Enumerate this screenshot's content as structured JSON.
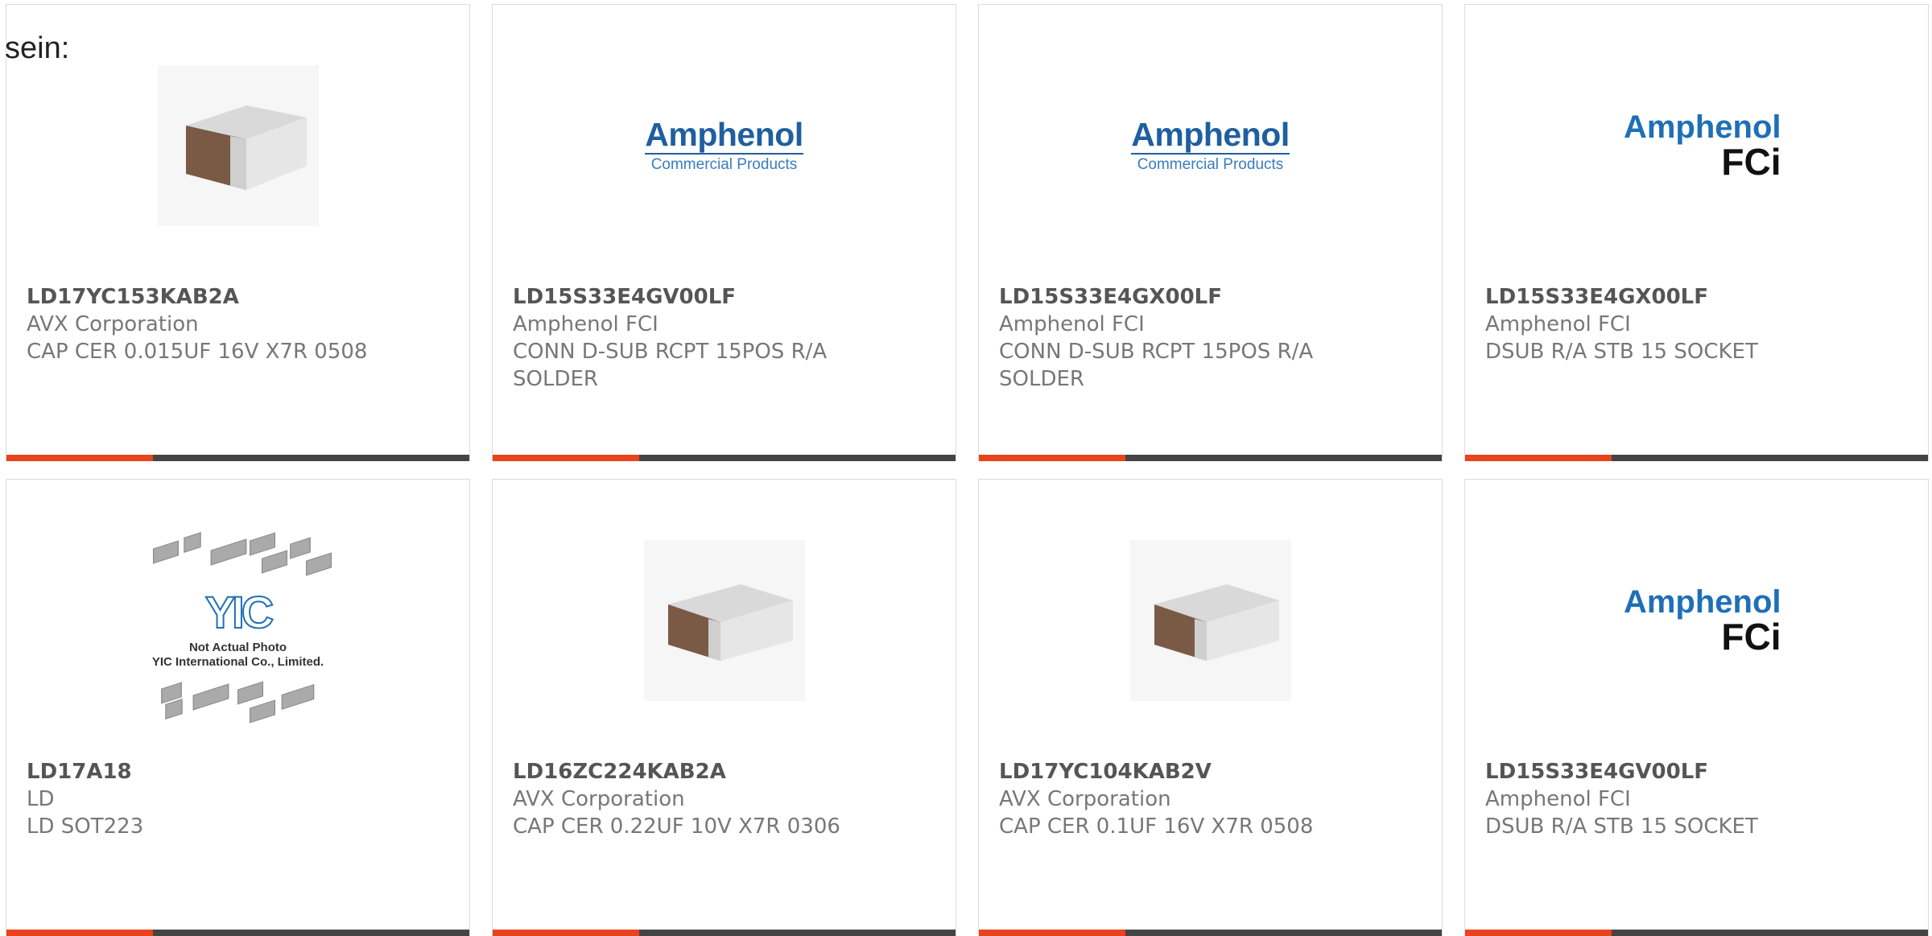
{
  "page": {
    "partial_label": "sein:"
  },
  "colors": {
    "accent_bar": "#e8431c",
    "dark_bar": "#444444",
    "amphenol_blue": "#1f6fb8",
    "capacitor_brown": "#7a5a45"
  },
  "logos": {
    "amphenol": "Amphenol",
    "commercial_products": "Commercial Products",
    "fci": "FCi",
    "yic": "YIC",
    "yic_notice_line1": "Not Actual Photo",
    "yic_notice_line2": "YIC International Co., Limited."
  },
  "products": [
    {
      "part_number": "LD17YC153KAB2A",
      "manufacturer": "AVX Corporation",
      "description": "CAP CER 0.015UF 16V X7R 0508",
      "image": "capacitor-chip"
    },
    {
      "part_number": "LD15S33E4GV00LF",
      "manufacturer": "Amphenol FCI",
      "description": "CONN D-SUB RCPT 15POS R/A SOLDER",
      "image": "amphenol-commercial-logo"
    },
    {
      "part_number": "LD15S33E4GX00LF",
      "manufacturer": "Amphenol FCI",
      "description": "CONN D-SUB RCPT 15POS R/A SOLDER",
      "image": "amphenol-commercial-logo"
    },
    {
      "part_number": "LD15S33E4GX00LF",
      "manufacturer": "Amphenol FCI",
      "description": "DSUB R/A STB 15 SOCKET",
      "image": "amphenol-fci-logo"
    },
    {
      "part_number": "LD17A18",
      "manufacturer": "LD",
      "description": "LD SOT223",
      "image": "yic-placeholder"
    },
    {
      "part_number": "LD16ZC224KAB2A",
      "manufacturer": "AVX Corporation",
      "description": "CAP CER 0.22UF 10V X7R 0306",
      "image": "capacitor-chip"
    },
    {
      "part_number": "LD17YC104KAB2V",
      "manufacturer": "AVX Corporation",
      "description": "CAP CER 0.1UF 16V X7R 0508",
      "image": "capacitor-chip"
    },
    {
      "part_number": "LD15S33E4GV00LF",
      "manufacturer": "Amphenol FCI",
      "description": "DSUB R/A STB 15 SOCKET",
      "image": "amphenol-fci-logo"
    }
  ]
}
